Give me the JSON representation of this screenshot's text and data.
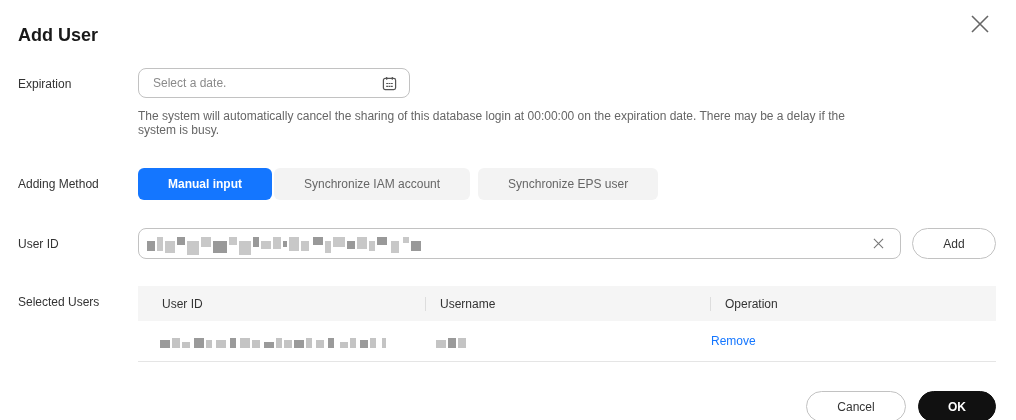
{
  "dialog": {
    "title": "Add User"
  },
  "expiration": {
    "label": "Expiration",
    "placeholder": "Select a date.",
    "hint": "The system will automatically cancel the sharing of this database login at 00:00:00 on the expiration date. There may be a delay if the system is busy."
  },
  "adding_method": {
    "label": "Adding Method",
    "options": [
      {
        "label": "Manual input",
        "selected": true
      },
      {
        "label": "Synchronize IAM account",
        "selected": false
      },
      {
        "label": "Synchronize EPS user",
        "selected": false
      }
    ]
  },
  "user_id": {
    "label": "User ID",
    "button": "Add"
  },
  "selected_users": {
    "label": "Selected Users",
    "columns": [
      "User ID",
      "Username",
      "Operation"
    ],
    "rows": [
      {
        "operation": "Remove"
      }
    ]
  },
  "buttons": [
    "Cancel",
    "OK"
  ]
}
